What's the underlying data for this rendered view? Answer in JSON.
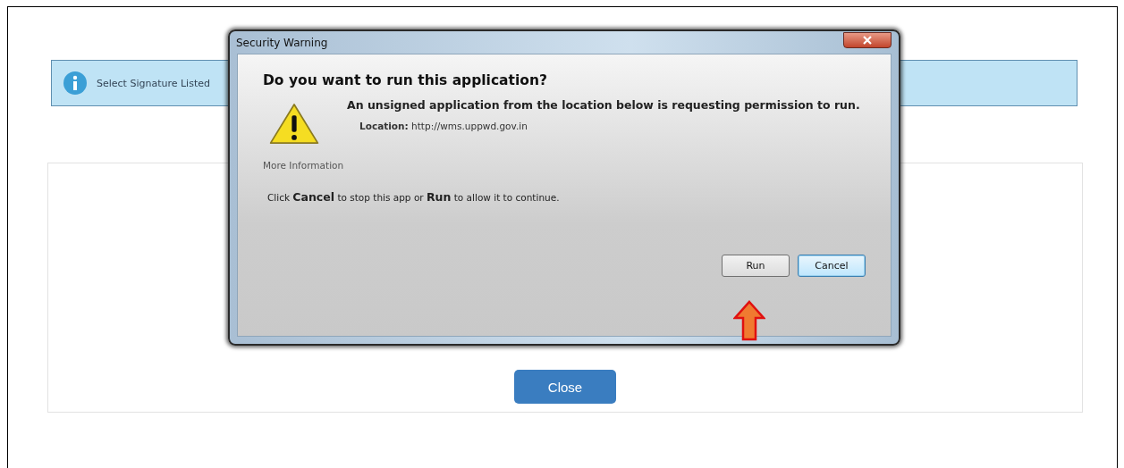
{
  "page": {
    "info_message": "Select Signature Listed",
    "close_button": "Close"
  },
  "dialog": {
    "title": "Security Warning",
    "heading": "Do you want to run this application?",
    "message": "An unsigned application from the location below is requesting permission to run.",
    "location": "**Location:** http://wms.uppwd.gov.in",
    "more_info_link": "More Information",
    "instruction": "Click **Cancel** to stop this app or **Run** to allow it to continue.",
    "buttons": [
      {
        "label": "Run",
        "focused": false
      },
      {
        "label": "Cancel",
        "focused": true
      }
    ]
  }
}
